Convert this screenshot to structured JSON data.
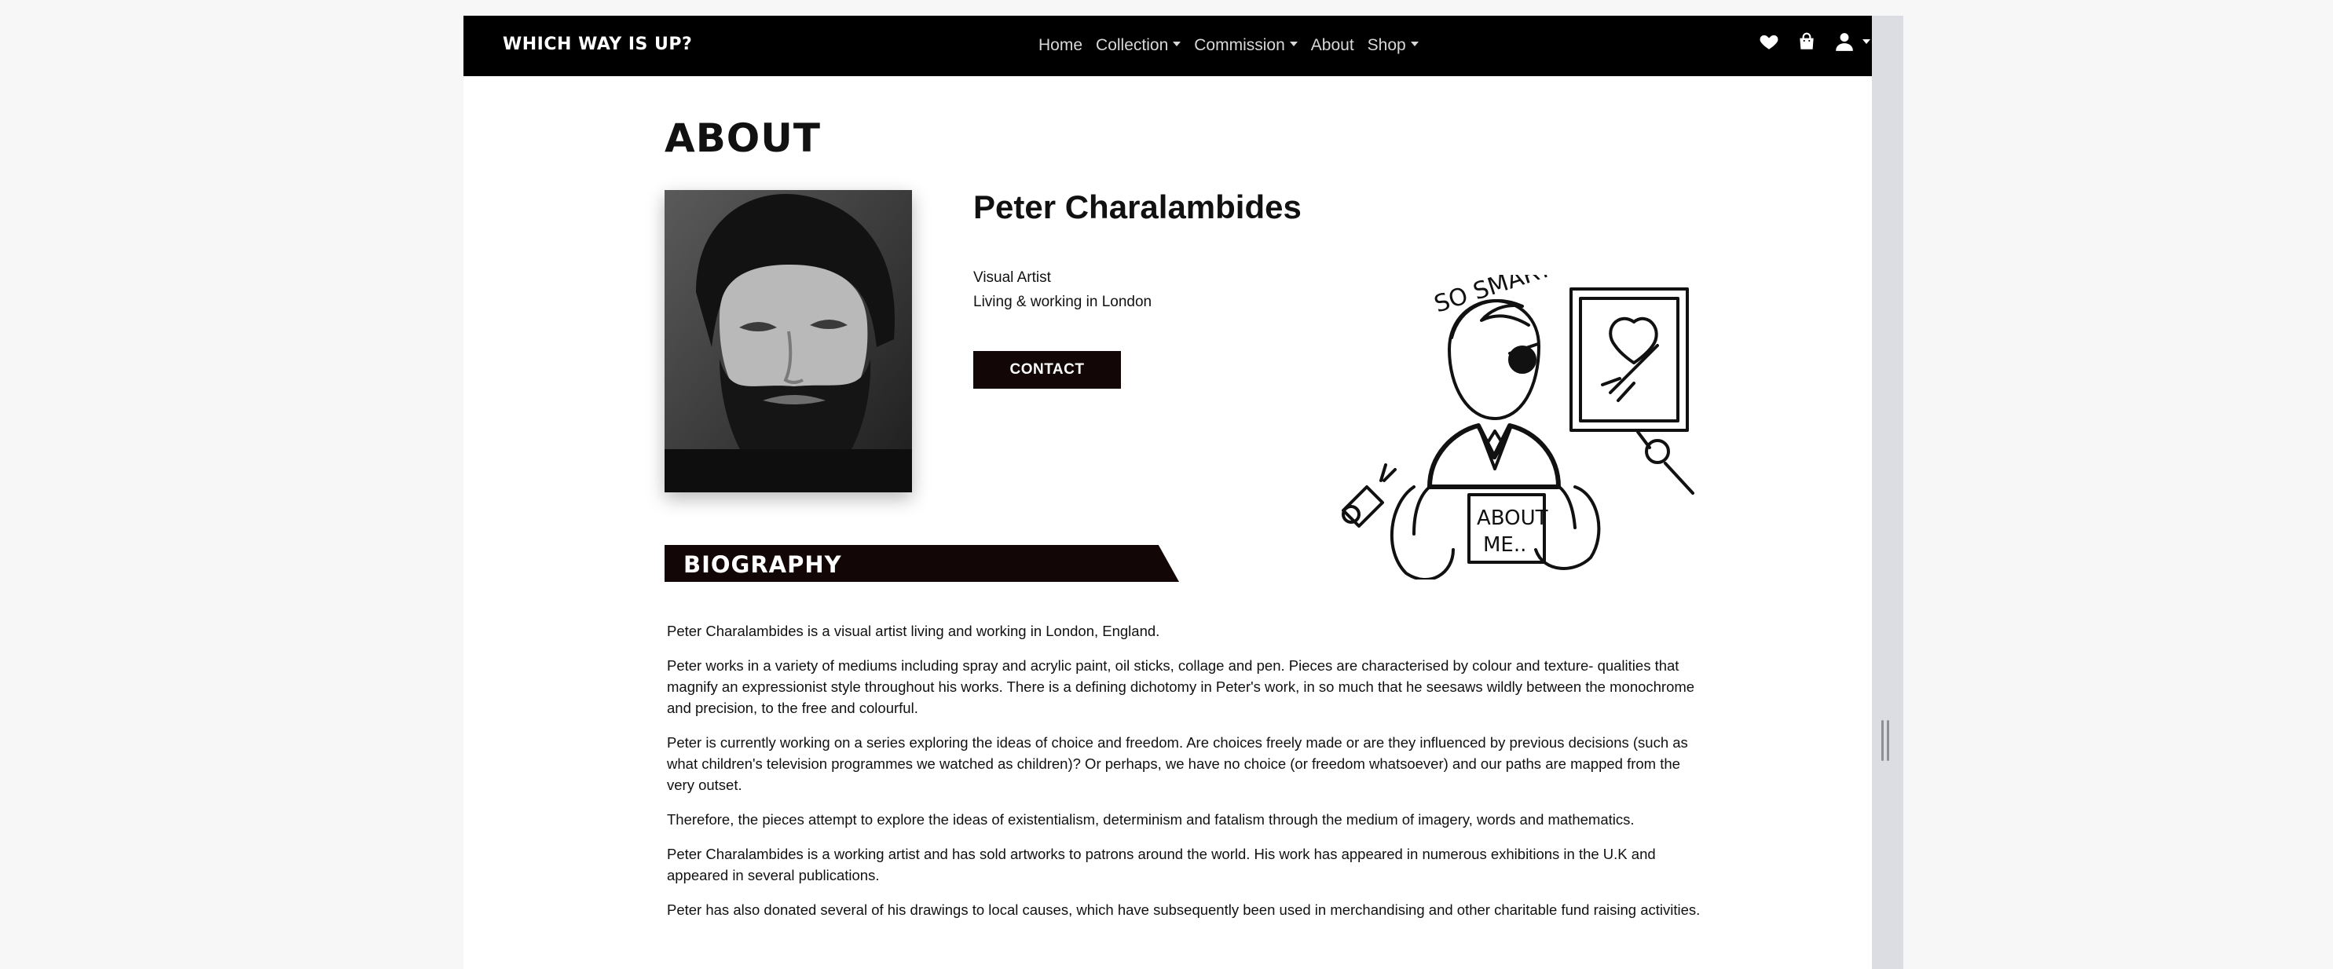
{
  "navbar": {
    "brand": "WHICH WAY IS UP?",
    "links": [
      {
        "label": "Home",
        "dropdown": false
      },
      {
        "label": "Collection",
        "dropdown": true
      },
      {
        "label": "Commission",
        "dropdown": true
      },
      {
        "label": "About",
        "dropdown": false
      },
      {
        "label": "Shop",
        "dropdown": true
      }
    ],
    "icons": [
      "heart-icon",
      "shopping-bag-icon",
      "user-icon"
    ]
  },
  "page": {
    "title": "ABOUT"
  },
  "artist": {
    "name": "Peter Charalambides",
    "role": "Visual Artist",
    "location": "Living & working in London",
    "contact_label": "CONTACT"
  },
  "illustration": {
    "caption_top": "SO SMART",
    "sign_line1": "ABOUT",
    "sign_line2": "ME.."
  },
  "biography": {
    "heading": "BIOGRAPHY",
    "paragraphs": [
      "Peter Charalambides is a visual artist living and working in London, England.",
      "Peter works in a variety of mediums including spray and acrylic paint, oil sticks, collage and pen. Pieces are characterised by colour and texture- qualities that magnify an expressionist style throughout his works. There is a defining dichotomy in Peter's work, in so much that he seesaws wildly between the monochrome and precision, to the free and colourful.",
      "Peter is currently working on a series exploring the ideas of choice and freedom. Are choices freely made or are they influenced by previous decisions (such as what children's television programmes we watched as children)? Or perhaps, we have no choice (or freedom whatsoever) and our paths are mapped from the very outset.",
      "Therefore, the pieces attempt to explore the ideas of existentialism, determinism and fatalism through the medium of imagery, words and mathematics.",
      "Peter Charalambides is a working artist and has sold artworks to patrons around the world. His work has appeared in numerous exhibitions in the U.K and appeared in several publications.",
      "Peter has also donated several of his drawings to local causes, which have subsequently been used in merchandising and other charitable fund raising activities."
    ]
  },
  "colors": {
    "navbar": "#000000",
    "accent_dark": "#120606",
    "page_bg": "#ffffff",
    "outer_bg": "#f7f7f7"
  }
}
